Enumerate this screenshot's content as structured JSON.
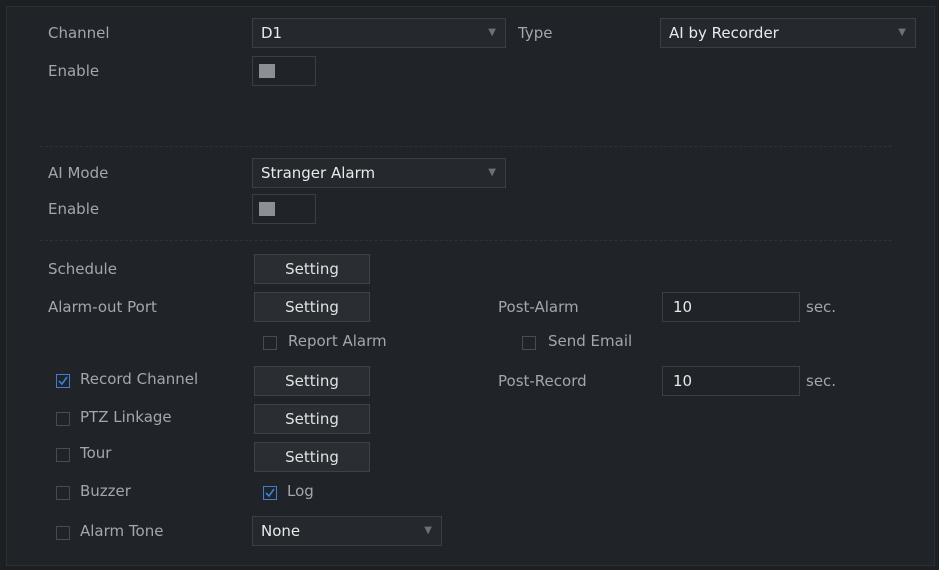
{
  "channel": {
    "label": "Channel",
    "value": "D1"
  },
  "type": {
    "label": "Type",
    "value": "AI by Recorder"
  },
  "enable_top": {
    "label": "Enable"
  },
  "ai_mode": {
    "label": "AI Mode",
    "value": "Stranger Alarm"
  },
  "enable_mode": {
    "label": "Enable"
  },
  "schedule": {
    "label": "Schedule",
    "button": "Setting"
  },
  "alarm_out": {
    "label": "Alarm-out Port",
    "button": "Setting"
  },
  "post_alarm": {
    "label": "Post-Alarm",
    "value": "10",
    "unit": "sec."
  },
  "report_alarm": {
    "label": "Report Alarm",
    "checked": false
  },
  "send_email": {
    "label": "Send Email",
    "checked": false
  },
  "record_channel": {
    "label": "Record Channel",
    "checked": true,
    "button": "Setting"
  },
  "post_record": {
    "label": "Post-Record",
    "value": "10",
    "unit": "sec."
  },
  "ptz_linkage": {
    "label": "PTZ Linkage",
    "checked": false,
    "button": "Setting"
  },
  "tour": {
    "label": "Tour",
    "checked": false,
    "button": "Setting"
  },
  "buzzer": {
    "label": "Buzzer",
    "checked": false
  },
  "log": {
    "label": "Log",
    "checked": true
  },
  "alarm_tone": {
    "label": "Alarm Tone",
    "checked": false,
    "value": "None"
  },
  "colors": {
    "background": "#202327",
    "accent": "#3f7fcf",
    "text": "#a3a7ac"
  }
}
